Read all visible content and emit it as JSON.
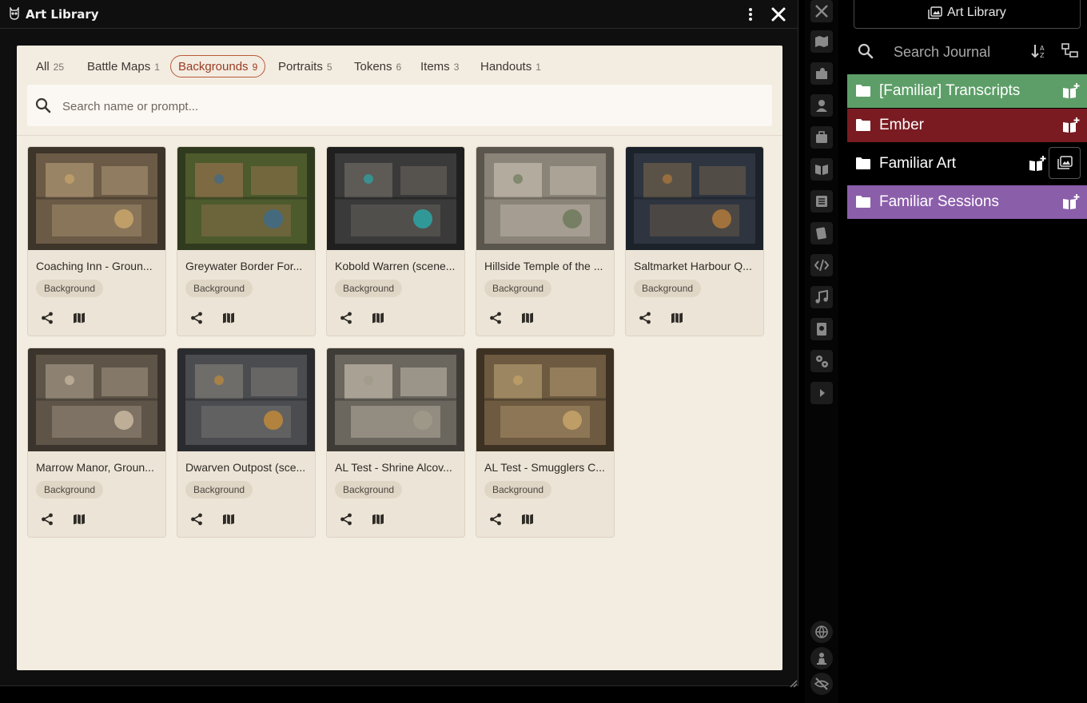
{
  "window": {
    "title": "Art Library"
  },
  "tabs": [
    {
      "label": "All",
      "count": "25"
    },
    {
      "label": "Battle Maps",
      "count": "1"
    },
    {
      "label": "Backgrounds",
      "count": "9",
      "active": true
    },
    {
      "label": "Portraits",
      "count": "5"
    },
    {
      "label": "Tokens",
      "count": "6"
    },
    {
      "label": "Items",
      "count": "3"
    },
    {
      "label": "Handouts",
      "count": "1"
    }
  ],
  "search": {
    "placeholder": "Search name or prompt..."
  },
  "cards": [
    {
      "title": "Coaching Inn - Groun...",
      "badge": "Background"
    },
    {
      "title": "Greywater Border For...",
      "badge": "Background"
    },
    {
      "title": "Kobold Warren (scene...",
      "badge": "Background"
    },
    {
      "title": "Hillside Temple of the ...",
      "badge": "Background"
    },
    {
      "title": "Saltmarket Harbour Q...",
      "badge": "Background"
    },
    {
      "title": "Marrow Manor, Groun...",
      "badge": "Background"
    },
    {
      "title": "Dwarven Outpost (sce...",
      "badge": "Background"
    },
    {
      "title": "AL Test - Shrine Alcov...",
      "badge": "Background"
    },
    {
      "title": "AL Test - Smugglers C...",
      "badge": "Background"
    }
  ],
  "toolbar": {
    "icons": [
      "crossed-swords-icon",
      "map-icon",
      "puzzle-icon",
      "user-icon",
      "suitcase-icon",
      "book-open-icon",
      "list-icon",
      "cards-icon",
      "code-icon",
      "music-icon",
      "compendium-icon",
      "gears-icon",
      "play-icon",
      "globe-icon",
      "chess-pawn-icon",
      "eye-slash-icon"
    ]
  },
  "sidebar": {
    "art_library_label": "Art Library",
    "search_placeholder": "Search Journal",
    "folders": [
      {
        "name": "[Familiar] Transcripts",
        "color": "#5d9e68"
      },
      {
        "name": "Ember",
        "color": "#7a1b22"
      },
      {
        "name": "Familiar Art",
        "color": "#000000"
      },
      {
        "name": "Familiar Sessions",
        "color": "#8b5eaa"
      }
    ]
  },
  "colors": {
    "panel_bg": "#f3ece1",
    "active_tab": "#b85a3a",
    "card_bg": "#ece4d7"
  }
}
